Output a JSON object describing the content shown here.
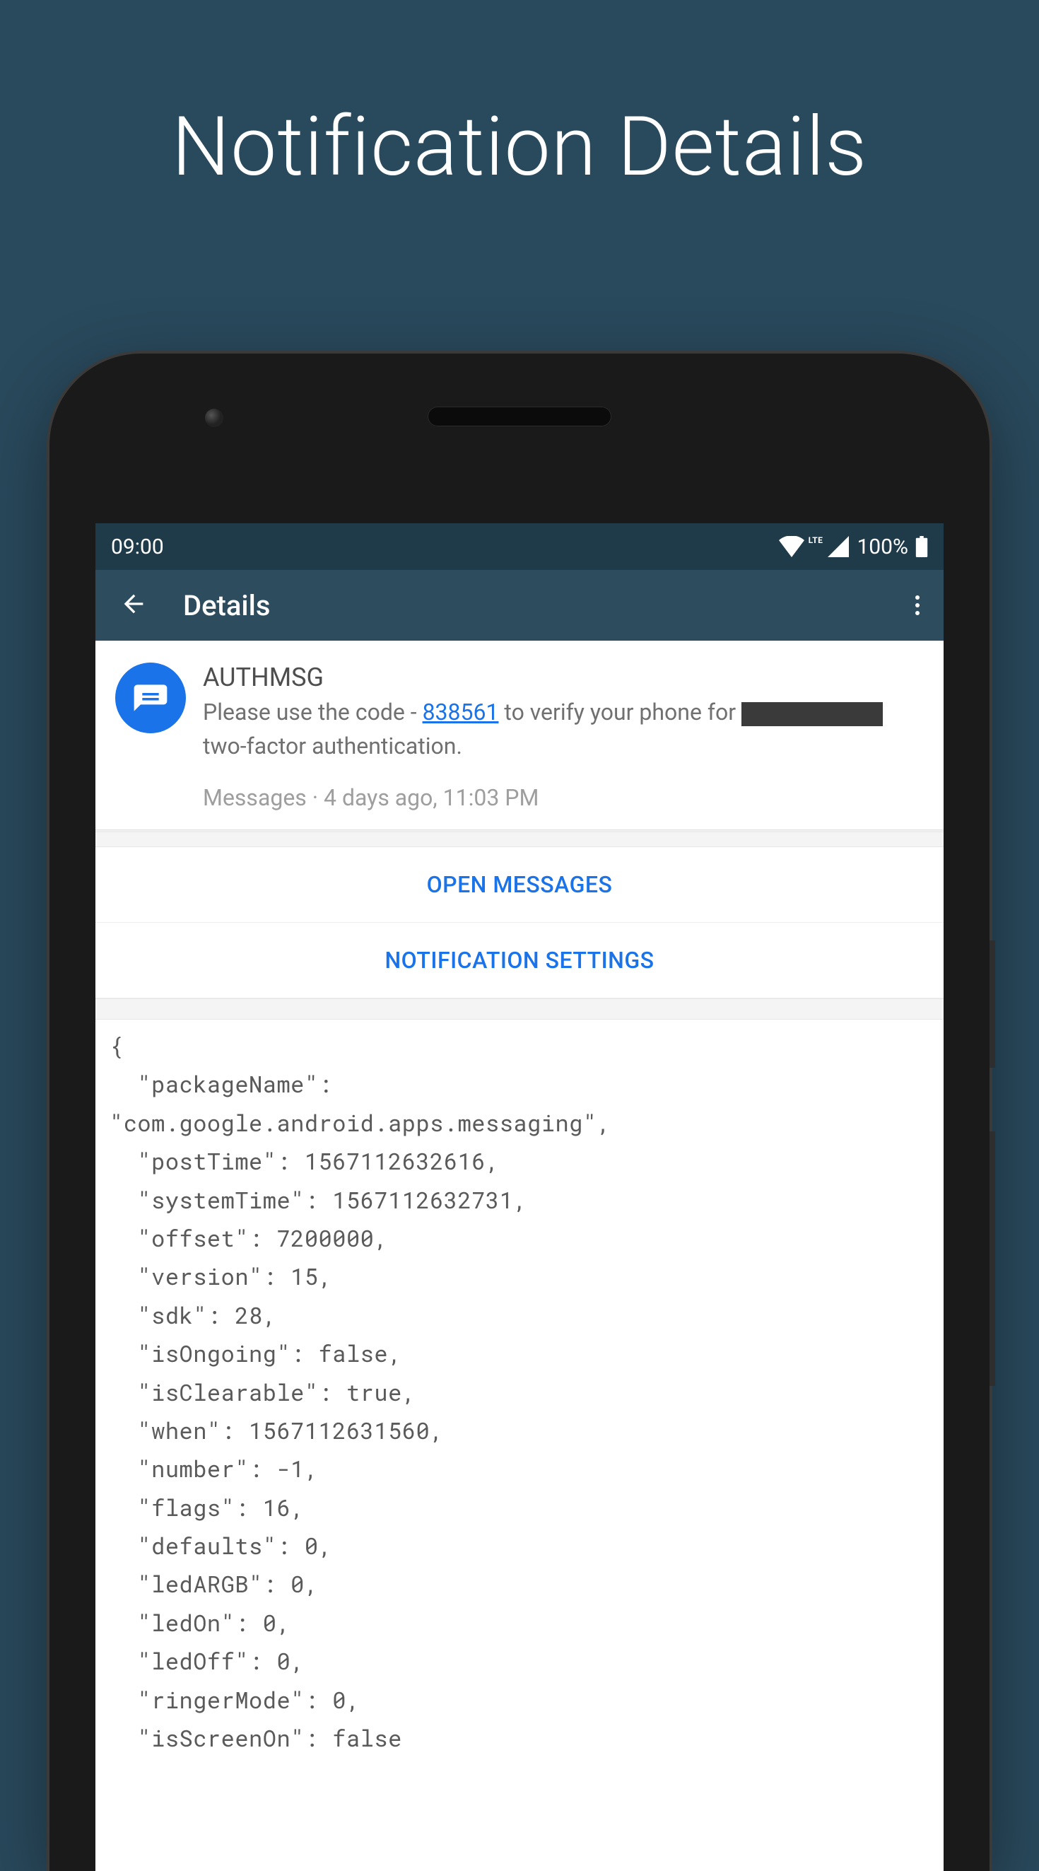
{
  "hero": {
    "title": "Notification Details"
  },
  "statusbar": {
    "time": "09:00",
    "battery": "100%"
  },
  "toolbar": {
    "title": "Details"
  },
  "notification": {
    "title": "AUTHMSG",
    "body_pre": "Please use the code - ",
    "code": "838561",
    "body_mid": " to verify your phone for ",
    "body_post": " two-factor authentication.",
    "app": "Messages",
    "sep": " · ",
    "time": "4 days ago, 11:03 PM"
  },
  "actions": {
    "open": "OPEN MESSAGES",
    "settings": "NOTIFICATION SETTINGS"
  },
  "json_dump": "{\n  \"packageName\":\n\"com.google.android.apps.messaging\",\n  \"postTime\": 1567112632616,\n  \"systemTime\": 1567112632731,\n  \"offset\": 7200000,\n  \"version\": 15,\n  \"sdk\": 28,\n  \"isOngoing\": false,\n  \"isClearable\": true,\n  \"when\": 1567112631560,\n  \"number\": -1,\n  \"flags\": 16,\n  \"defaults\": 0,\n  \"ledARGB\": 0,\n  \"ledOn\": 0,\n  \"ledOff\": 0,\n  \"ringerMode\": 0,\n  \"isScreenOn\": false"
}
